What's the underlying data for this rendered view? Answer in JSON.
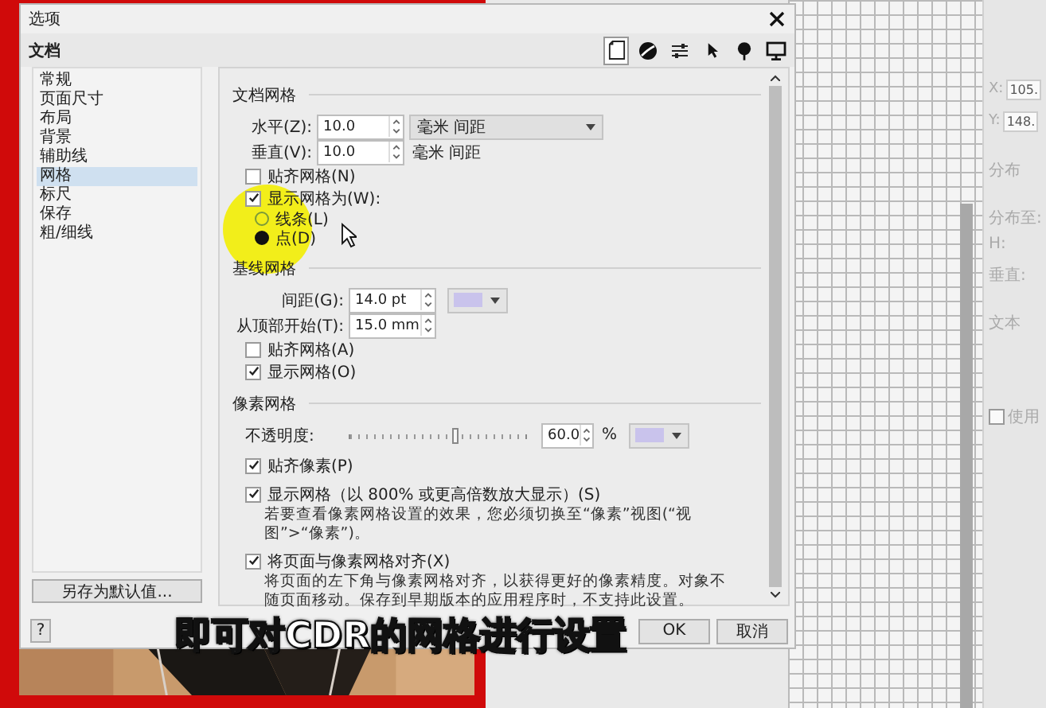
{
  "side_panel": [
    {
      "kind": "field",
      "label": "X:",
      "value": "105."
    },
    {
      "kind": "field",
      "label": "Y:",
      "value": "148."
    },
    {
      "kind": "heading",
      "label": "分布"
    },
    {
      "kind": "heading",
      "label": "分布至:"
    },
    {
      "kind": "label",
      "label": "H:"
    },
    {
      "kind": "label",
      "label": "垂直:"
    },
    {
      "kind": "heading",
      "label": "文本"
    },
    {
      "kind": "check",
      "label": "使用",
      "checked": false
    }
  ],
  "dialog": {
    "title": "选项",
    "section": "文档",
    "toolbar": [
      {
        "kind": "page",
        "selected": true
      },
      {
        "kind": "ball",
        "selected": false
      },
      {
        "kind": "sliders",
        "selected": false
      },
      {
        "kind": "pointer",
        "selected": false
      },
      {
        "kind": "pin",
        "selected": false
      },
      {
        "kind": "monitor",
        "selected": false
      }
    ],
    "nav": [
      {
        "label": "常规",
        "selected": false
      },
      {
        "label": "页面尺寸",
        "selected": false
      },
      {
        "label": "布局",
        "selected": false
      },
      {
        "label": "背景",
        "selected": false
      },
      {
        "label": "辅助线",
        "selected": false
      },
      {
        "label": "网格",
        "selected": true
      },
      {
        "label": "标尺",
        "selected": false
      },
      {
        "label": "保存",
        "selected": false
      },
      {
        "label": "粗/细线",
        "selected": false
      }
    ],
    "save_default_button": "另存为默认值...",
    "help_button": "?",
    "ok_button": "OK",
    "cancel_button": "取消"
  },
  "document_grid": {
    "heading": "文档网格",
    "horizontal": {
      "label": "水平(Z):",
      "value": "10.0",
      "unit": "毫米 间距"
    },
    "vertical": {
      "label": "垂直(V):",
      "value": "10.0",
      "unit": "毫米 间距"
    },
    "snap": {
      "label": "贴齐网格(N)",
      "checked": false
    },
    "show": {
      "label": "显示网格为(W):",
      "checked": true
    },
    "styles": [
      {
        "label": "线条(L)",
        "selected": false
      },
      {
        "label": "点(D)",
        "selected": true
      }
    ]
  },
  "baseline_grid": {
    "heading": "基线网格",
    "spacing": {
      "label": "间距(G):",
      "value": "14.0 pt",
      "color": "#c9c3ec"
    },
    "from_top": {
      "label": "从顶部开始(T):",
      "value": "15.0 mm"
    },
    "snap": {
      "label": "贴齐网格(A)",
      "checked": false
    },
    "show": {
      "label": "显示网格(O)",
      "checked": true
    }
  },
  "pixel_grid": {
    "heading": "像素网格",
    "opacity": {
      "label": "不透明度:",
      "level": 0.6,
      "value": "60.0",
      "unit": "%",
      "color": "#c9c3ec"
    },
    "options": [
      {
        "label": "贴齐像素(P)",
        "checked": true
      },
      {
        "label": "显示网格（以 800% 或更高倍数放大显示）(S)",
        "checked": true,
        "note": "若要查看像素网格设置的效果，您必须切换至“像素”视图(“视图”>“像素”)。"
      },
      {
        "label": "将页面与像素网格对齐(X)",
        "checked": true,
        "note": "将页面的左下角与像素网格对齐，以获得更好的像素精度。对象不随页面移动。保存到早期版本的应用程序时，不支持此设置。"
      }
    ]
  },
  "caption": "即可对CDR的网格进行设置"
}
